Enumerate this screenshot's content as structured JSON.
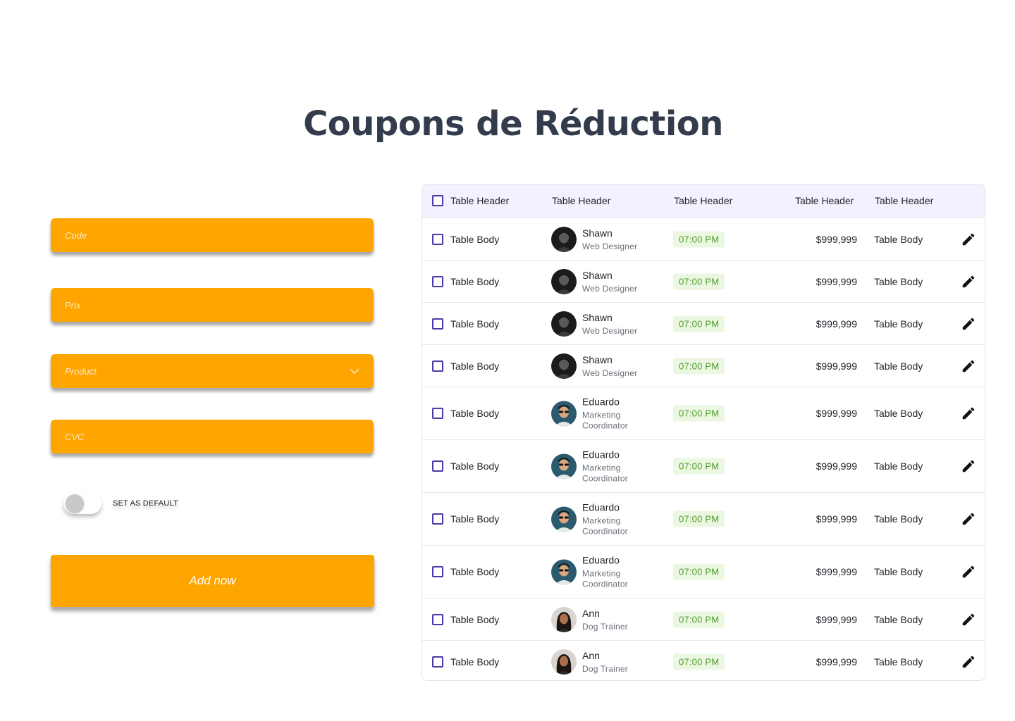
{
  "page": {
    "title": "Coupons de Réduction"
  },
  "form": {
    "code_placeholder": "Code",
    "price_placeholder": "Prix",
    "product_placeholder": "Product",
    "cvc_placeholder": "CVC",
    "default_label": "SET AS DEFAULT",
    "default_on": false,
    "submit_label": "Add now"
  },
  "colors": {
    "accent": "#ffa500",
    "checkbox": "#4b3aa8",
    "header_bg": "#f3f1fd",
    "time_bg": "#ecf7e2",
    "time_text": "#4c9a2a"
  },
  "table": {
    "headers": [
      "Table Header",
      "Table Header",
      "Table Header",
      "Table Header",
      "Table Header"
    ],
    "rows": [
      {
        "col1": "Table Body",
        "name": "Shawn",
        "role": "Web Designer",
        "avatar": "avatar-shawn",
        "time": "07:00 PM",
        "price": "$999,999",
        "col5": "Table Body"
      },
      {
        "col1": "Table Body",
        "name": "Shawn",
        "role": "Web Designer",
        "avatar": "avatar-shawn",
        "time": "07:00 PM",
        "price": "$999,999",
        "col5": "Table Body"
      },
      {
        "col1": "Table Body",
        "name": "Shawn",
        "role": "Web Designer",
        "avatar": "avatar-shawn",
        "time": "07:00 PM",
        "price": "$999,999",
        "col5": "Table Body"
      },
      {
        "col1": "Table Body",
        "name": "Shawn",
        "role": "Web Designer",
        "avatar": "avatar-shawn",
        "time": "07:00 PM",
        "price": "$999,999",
        "col5": "Table Body"
      },
      {
        "col1": "Table Body",
        "name": "Eduardo",
        "role": "Marketing Coordinator",
        "avatar": "avatar-eduardo",
        "time": "07:00 PM",
        "price": "$999,999",
        "col5": "Table Body"
      },
      {
        "col1": "Table Body",
        "name": "Eduardo",
        "role": "Marketing Coordinator",
        "avatar": "avatar-eduardo",
        "time": "07:00 PM",
        "price": "$999,999",
        "col5": "Table Body"
      },
      {
        "col1": "Table Body",
        "name": "Eduardo",
        "role": "Marketing Coordinator",
        "avatar": "avatar-eduardo",
        "time": "07:00 PM",
        "price": "$999,999",
        "col5": "Table Body"
      },
      {
        "col1": "Table Body",
        "name": "Eduardo",
        "role": "Marketing Coordinator",
        "avatar": "avatar-eduardo",
        "time": "07:00 PM",
        "price": "$999,999",
        "col5": "Table Body"
      },
      {
        "col1": "Table Body",
        "name": "Ann",
        "role": "Dog Trainer",
        "avatar": "avatar-ann",
        "time": "07:00 PM",
        "price": "$999,999",
        "col5": "Table Body"
      },
      {
        "col1": "Table Body",
        "name": "Ann",
        "role": "Dog Trainer",
        "avatar": "avatar-ann",
        "time": "07:00 PM",
        "price": "$999,999",
        "col5": "Table Body"
      }
    ]
  }
}
